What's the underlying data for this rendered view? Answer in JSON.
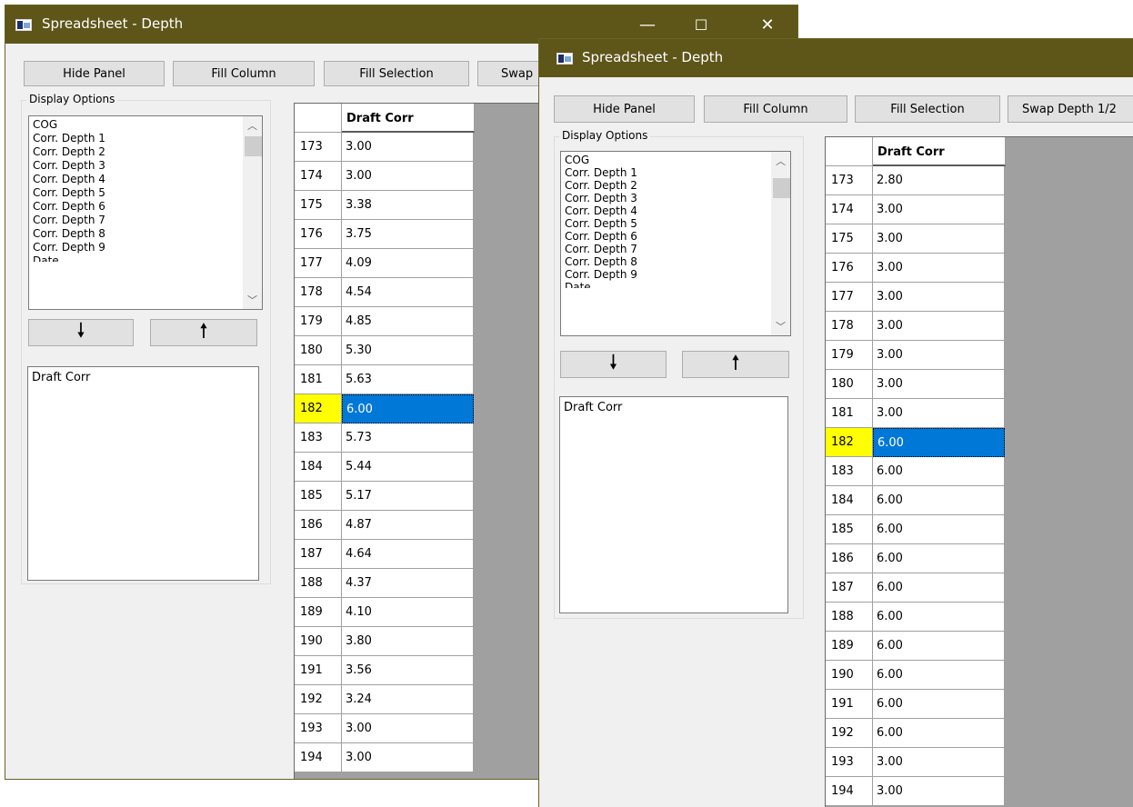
{
  "win1": {
    "title": "Spreadsheet - Depth",
    "controls": {
      "minimize": "—",
      "maximize": "☐",
      "close": "✕"
    },
    "buttons": {
      "hide_panel": "Hide Panel",
      "fill_column": "Fill Column",
      "fill_selection": "Fill Selection",
      "swap": "Swap"
    },
    "display_options": {
      "label": "Display Options",
      "items": [
        "COG",
        "Corr. Depth 1",
        "Corr. Depth 2",
        "Corr. Depth 3",
        "Corr. Depth 4",
        "Corr. Depth 5",
        "Corr. Depth 6",
        "Corr. Depth 7",
        "Corr. Depth 8",
        "Corr. Depth 9",
        "Date"
      ]
    },
    "arrows": {
      "down": "🠗",
      "up": "🠕"
    },
    "selected_columns": [
      "Draft Corr"
    ],
    "grid": {
      "column": "Draft Corr",
      "selected_row": "182",
      "rows": [
        {
          "num": "173",
          "value": "3.00"
        },
        {
          "num": "174",
          "value": "3.00"
        },
        {
          "num": "175",
          "value": "3.38"
        },
        {
          "num": "176",
          "value": "3.75"
        },
        {
          "num": "177",
          "value": "4.09"
        },
        {
          "num": "178",
          "value": "4.54"
        },
        {
          "num": "179",
          "value": "4.85"
        },
        {
          "num": "180",
          "value": "5.30"
        },
        {
          "num": "181",
          "value": "5.63"
        },
        {
          "num": "182",
          "value": "6.00"
        },
        {
          "num": "183",
          "value": "5.73"
        },
        {
          "num": "184",
          "value": "5.44"
        },
        {
          "num": "185",
          "value": "5.17"
        },
        {
          "num": "186",
          "value": "4.87"
        },
        {
          "num": "187",
          "value": "4.64"
        },
        {
          "num": "188",
          "value": "4.37"
        },
        {
          "num": "189",
          "value": "4.10"
        },
        {
          "num": "190",
          "value": "3.80"
        },
        {
          "num": "191",
          "value": "3.56"
        },
        {
          "num": "192",
          "value": "3.24"
        },
        {
          "num": "193",
          "value": "3.00"
        },
        {
          "num": "194",
          "value": "3.00"
        }
      ]
    }
  },
  "win2": {
    "title": "Spreadsheet - Depth",
    "buttons": {
      "hide_panel": "Hide Panel",
      "fill_column": "Fill Column",
      "fill_selection": "Fill Selection",
      "swap": "Swap Depth 1/2"
    },
    "display_options": {
      "label": "Display Options",
      "items": [
        "COG",
        "Corr. Depth 1",
        "Corr. Depth 2",
        "Corr. Depth 3",
        "Corr. Depth 4",
        "Corr. Depth 5",
        "Corr. Depth 6",
        "Corr. Depth 7",
        "Corr. Depth 8",
        "Corr. Depth 9",
        "Date"
      ]
    },
    "arrows": {
      "down": "🠗",
      "up": "🠕"
    },
    "selected_columns": [
      "Draft Corr"
    ],
    "grid": {
      "column": "Draft Corr",
      "selected_row": "182",
      "rows": [
        {
          "num": "173",
          "value": "2.80"
        },
        {
          "num": "174",
          "value": "3.00"
        },
        {
          "num": "175",
          "value": "3.00"
        },
        {
          "num": "176",
          "value": "3.00"
        },
        {
          "num": "177",
          "value": "3.00"
        },
        {
          "num": "178",
          "value": "3.00"
        },
        {
          "num": "179",
          "value": "3.00"
        },
        {
          "num": "180",
          "value": "3.00"
        },
        {
          "num": "181",
          "value": "3.00"
        },
        {
          "num": "182",
          "value": "6.00"
        },
        {
          "num": "183",
          "value": "6.00"
        },
        {
          "num": "184",
          "value": "6.00"
        },
        {
          "num": "185",
          "value": "6.00"
        },
        {
          "num": "186",
          "value": "6.00"
        },
        {
          "num": "187",
          "value": "6.00"
        },
        {
          "num": "188",
          "value": "6.00"
        },
        {
          "num": "189",
          "value": "6.00"
        },
        {
          "num": "190",
          "value": "6.00"
        },
        {
          "num": "191",
          "value": "6.00"
        },
        {
          "num": "192",
          "value": "6.00"
        },
        {
          "num": "193",
          "value": "3.00"
        },
        {
          "num": "194",
          "value": "3.00"
        }
      ]
    }
  }
}
